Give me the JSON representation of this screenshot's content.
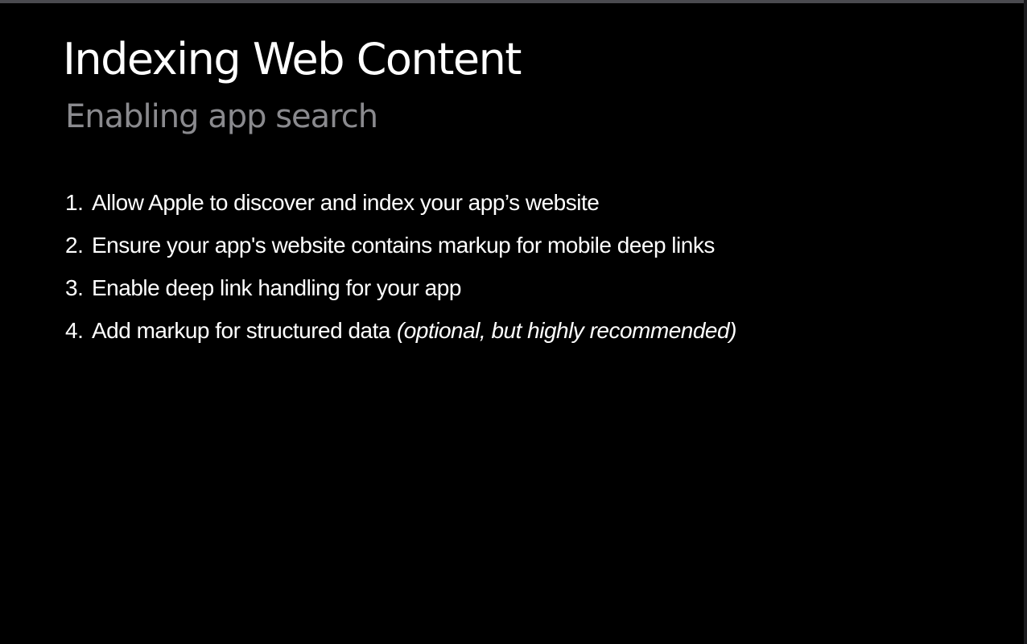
{
  "slide": {
    "title": "Indexing Web Content",
    "subtitle": "Enabling app search",
    "steps": [
      {
        "number": "1.",
        "text": "Allow Apple to discover and index your app’s website",
        "note": ""
      },
      {
        "number": "2.",
        "text": "Ensure your app's website contains markup for mobile deep links",
        "note": ""
      },
      {
        "number": "3.",
        "text": "Enable deep link handling for your app",
        "note": ""
      },
      {
        "number": "4.",
        "text": "Add markup for structured data",
        "note": "(optional, but highly recommended)"
      }
    ]
  },
  "colors": {
    "background": "#000000",
    "title": "#ffffff",
    "subtitle": "#8a8a8e",
    "body_text": "#ffffff",
    "top_border": "#4a4a4f"
  }
}
